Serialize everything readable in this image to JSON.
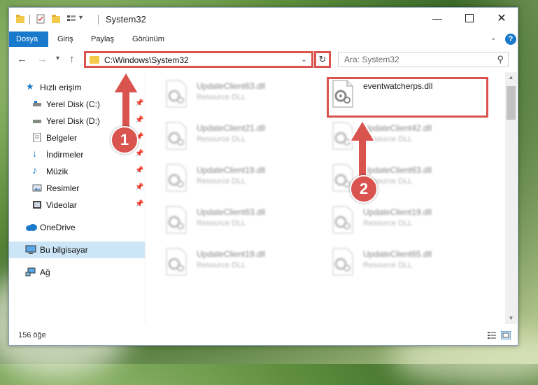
{
  "window": {
    "title": "System32"
  },
  "ribbon": {
    "tabs": [
      "Dosya",
      "Giriş",
      "Paylaş",
      "Görünüm"
    ]
  },
  "navbar": {
    "address_path": "C:\\Windows\\System32",
    "search_placeholder": "Ara: System32"
  },
  "sidebar": {
    "items": [
      {
        "label": "Hızlı erişim",
        "icon": "star-icon"
      },
      {
        "label": "Yerel Disk (C:)",
        "icon": "drive-icon"
      },
      {
        "label": "Yerel Disk (D:)",
        "icon": "drive-icon"
      },
      {
        "label": "Belgeler",
        "icon": "documents-icon"
      },
      {
        "label": "İndirmeler",
        "icon": "download-icon"
      },
      {
        "label": "Müzik",
        "icon": "music-icon"
      },
      {
        "label": "Resimler",
        "icon": "pictures-icon"
      },
      {
        "label": "Videolar",
        "icon": "videos-icon"
      },
      {
        "label": "OneDrive",
        "icon": "cloud-icon"
      },
      {
        "label": "Bu bilgisayar",
        "icon": "computer-icon"
      },
      {
        "label": "Ağ",
        "icon": "network-icon"
      }
    ]
  },
  "files": [
    {
      "name": "UpdateClient63.dll",
      "desc": "Resource DLL"
    },
    {
      "name": "eventwatcherps.dll",
      "desc": ""
    },
    {
      "name": "UpdateClient21.dll",
      "desc": "Resource DLL"
    },
    {
      "name": "UpdateClient42.dll",
      "desc": "Resource DLL"
    },
    {
      "name": "UpdateClient19.dll",
      "desc": "Resource DLL"
    },
    {
      "name": "UpdateClient63.dll",
      "desc": "Resource DLL"
    },
    {
      "name": "UpdateClient63.dll",
      "desc": "Resource DLL"
    },
    {
      "name": "UpdateClient19.dll",
      "desc": "Resource DLL"
    },
    {
      "name": "UpdateClient19.dll",
      "desc": "Resource DLL"
    },
    {
      "name": "UpdateClient65.dll",
      "desc": "Resource DLL"
    }
  ],
  "status": {
    "item_count": "156 öğe"
  },
  "annotations": {
    "badge1": "1",
    "badge2": "2"
  },
  "colors": {
    "accent": "#1979ca",
    "highlight": "#d9534f",
    "selected": "#cde6f7"
  }
}
